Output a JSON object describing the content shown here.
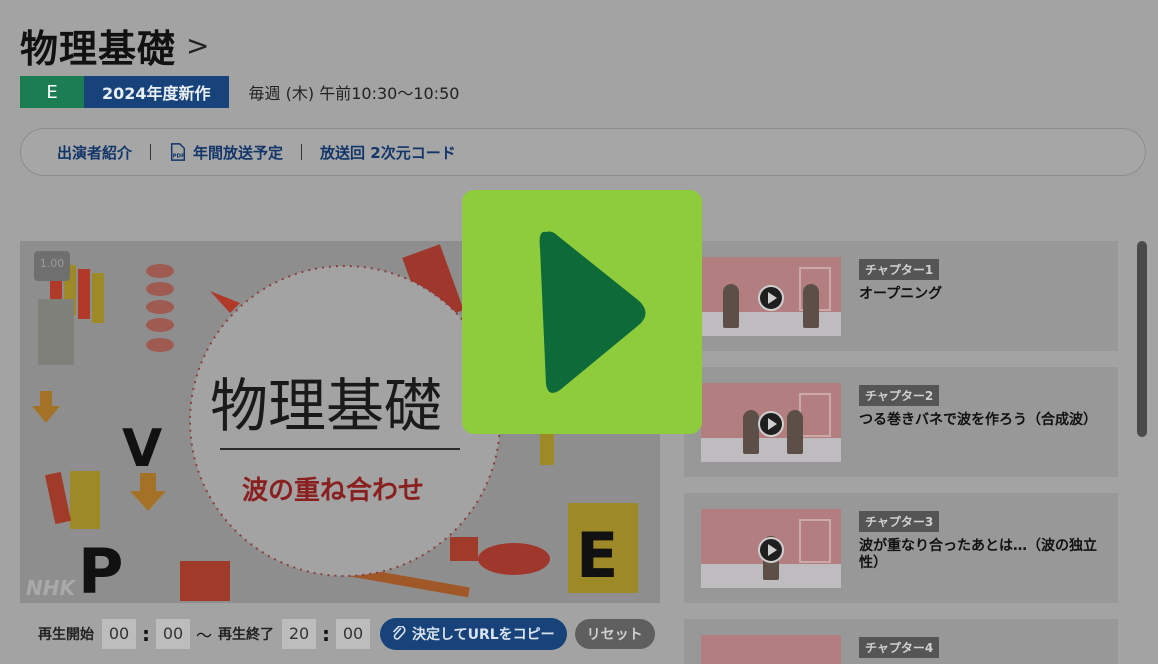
{
  "header": {
    "title": "物理基礎",
    "chevron": ">",
    "channel_badge": "E",
    "new_badge": "2024年度新作",
    "schedule": "毎週 (木) 午前10:30～10:50"
  },
  "nav": {
    "cast": "出演者紹介",
    "pdf_icon_text": "PDF",
    "schedule_pdf": "年間放送予定",
    "qr_code": "放送回 2次元コード"
  },
  "player": {
    "version_badge": "1.00",
    "video_title": "物理基礎",
    "video_subtitle": "波の重ね合わせ",
    "watermark": "NHK",
    "letters": {
      "v": "V",
      "p": "P",
      "e": "E"
    }
  },
  "controls": {
    "start_label": "再生開始",
    "start_min": "00",
    "start_sec": "00",
    "tilde": "〜",
    "end_label": "再生終了",
    "end_min": "20",
    "end_sec": "00",
    "colon": ":",
    "copy_button": "決定してURLをコピー",
    "reset_button": "リセット"
  },
  "chapters": [
    {
      "badge": "チャプター1",
      "title": "オープニング"
    },
    {
      "badge": "チャプター2",
      "title": "つる巻きバネで波を作ろう（合成波）"
    },
    {
      "badge": "チャプター3",
      "title": "波が重なり合ったあとは…（波の独立性）"
    },
    {
      "badge": "チャプター4",
      "title": ""
    }
  ],
  "colors": {
    "overlay_bg": "#a3a3a3",
    "channel_green": "#1d7d52",
    "brand_blue": "#17427a",
    "play_button_green": "#8fcc3c",
    "play_triangle": "#0f6a39"
  }
}
